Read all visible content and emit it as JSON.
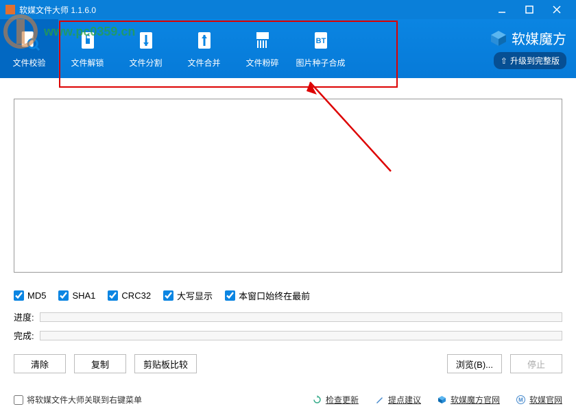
{
  "window": {
    "title": "软媒文件大师 1.1.6.0"
  },
  "tabs": [
    {
      "label": "文件校验"
    },
    {
      "label": "文件解锁"
    },
    {
      "label": "文件分割"
    },
    {
      "label": "文件合并"
    },
    {
      "label": "文件粉碎"
    },
    {
      "label": "图片种子合成"
    }
  ],
  "brand": {
    "name": "软媒魔方",
    "upgrade": "升级到完整版"
  },
  "checks": {
    "md5": "MD5",
    "sha1": "SHA1",
    "crc32": "CRC32",
    "uppercase": "大写显示",
    "topmost": "本窗口始终在最前"
  },
  "progress": {
    "label1": "进度:",
    "label2": "完成:"
  },
  "buttons": {
    "clear": "清除",
    "copy": "复制",
    "clipboard": "剪贴板比较",
    "browse": "浏览(B)...",
    "stop": "停止"
  },
  "footer": {
    "context": "将软媒文件大师关联到右键菜单",
    "update": "检查更新",
    "suggest": "提点建议",
    "site1": "软媒魔方官网",
    "site2": "软媒官网"
  },
  "watermark": {
    "url": "www.pc0359.cn"
  }
}
